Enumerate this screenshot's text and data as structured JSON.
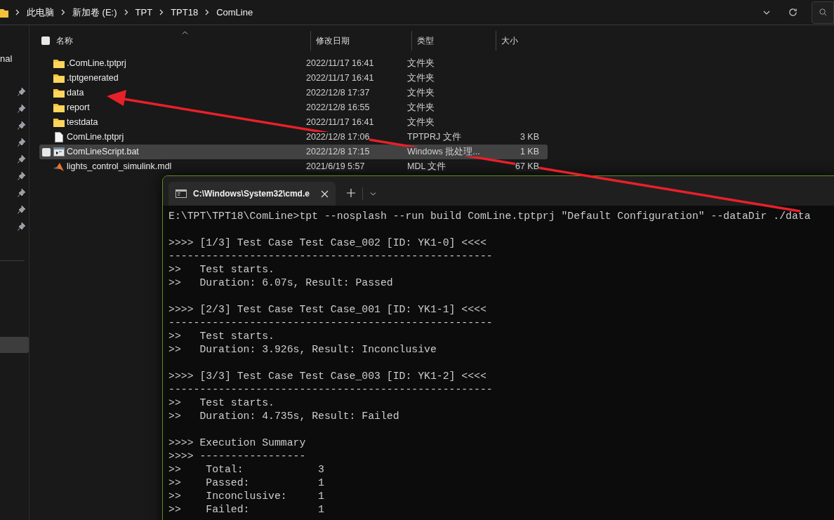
{
  "breadcrumb": [
    "此电脑",
    "新加卷 (E:)",
    "TPT",
    "TPT18",
    "ComLine"
  ],
  "sidebar": {
    "partial_label": "nal"
  },
  "select_all": {
    "checked": false
  },
  "columns": [
    "名称",
    "修改日期",
    "类型",
    "大小"
  ],
  "files": [
    {
      "kind": "folder",
      "name": ".ComLine.tptprj",
      "modified": "2022/11/17 16:41",
      "type": "文件夹",
      "selected": false
    },
    {
      "kind": "folder",
      "name": ".tptgenerated",
      "modified": "2022/11/17 16:41",
      "type": "文件夹",
      "selected": false
    },
    {
      "kind": "folder",
      "name": "data",
      "modified": "2022/12/8 17:37",
      "type": "文件夹",
      "selected": false
    },
    {
      "kind": "folder",
      "name": "report",
      "modified": "2022/12/8 16:55",
      "type": "文件夹",
      "selected": false
    },
    {
      "kind": "folder",
      "name": "testdata",
      "modified": "2022/11/17 16:41",
      "type": "文件夹",
      "selected": false
    },
    {
      "kind": "file",
      "name": "ComLine.tptprj",
      "modified": "2022/12/8 17:06",
      "type": "TPTPRJ 文件",
      "size": "3 KB",
      "selected": false
    },
    {
      "kind": "script",
      "name": "ComLineScript.bat",
      "modified": "2022/12/8 17:15",
      "type": "Windows 批处理...",
      "size": "1 KB",
      "selected": true
    },
    {
      "kind": "model",
      "name": "lights_control_simulink.mdl",
      "modified": "2021/6/19 5:57",
      "type": "MDL 文件",
      "size": "67 KB",
      "selected": false
    }
  ],
  "terminal": {
    "tab_title": "C:\\Windows\\System32\\cmd.e",
    "output_blocks": [
      [
        "E:\\TPT\\TPT18\\ComLine>tpt --nosplash --run build ComLine.tptprj \"Default Configuration\" --dataDir ./data"
      ],
      [
        ">>>> [1/3] Test Case Test Case_002 [ID: YK1-0] <<<<",
        "----------------------------------------------------",
        ">>   Test starts.",
        ">>   Duration: 6.07s, Result: Passed"
      ],
      [
        ">>>> [2/3] Test Case Test Case_001 [ID: YK1-1] <<<<",
        "----------------------------------------------------",
        ">>   Test starts.",
        ">>   Duration: 3.926s, Result: Inconclusive"
      ],
      [
        ">>>> [3/3] Test Case Test Case_003 [ID: YK1-2] <<<<",
        "----------------------------------------------------",
        ">>   Test starts.",
        ">>   Duration: 4.735s, Result: Failed"
      ],
      [
        ">>>> Execution Summary",
        ">>>> -----------------",
        ">>    Total:            3",
        ">>    Passed:           1",
        ">>    Inconclusive:     1",
        ">>    Failed:           1"
      ]
    ]
  }
}
